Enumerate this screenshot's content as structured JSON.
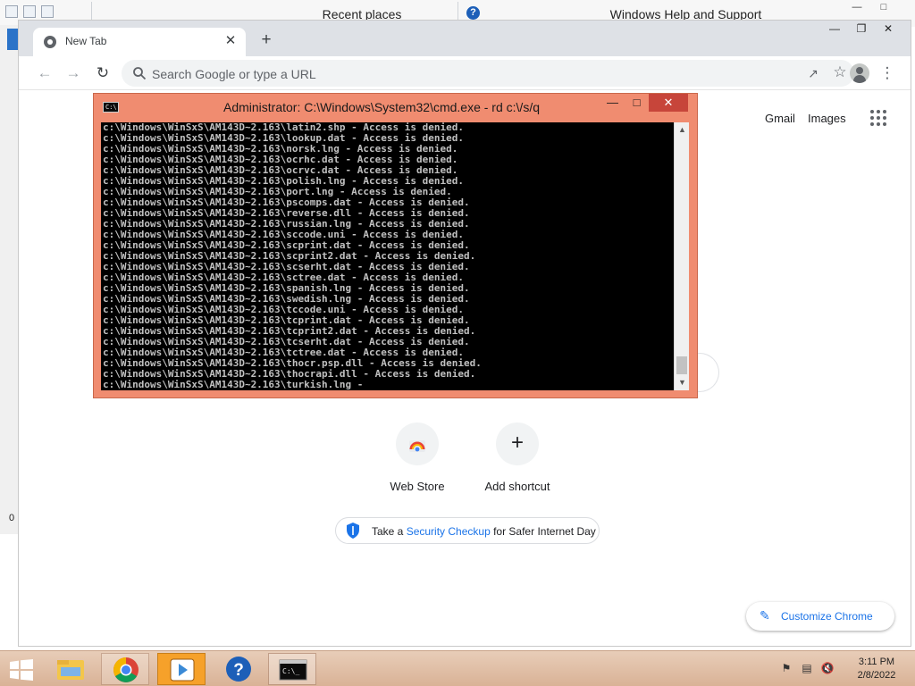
{
  "background": {
    "recent_places": "Recent places",
    "help_title": "Windows Help and Support",
    "side_value": "0"
  },
  "browser": {
    "tab_title": "New Tab",
    "omnibox_placeholder": "Search Google or type a URL",
    "links": {
      "gmail": "Gmail",
      "images": "Images"
    },
    "shortcuts": [
      {
        "label": "Web Store",
        "icon": "web-store-icon"
      },
      {
        "label": "Add shortcut",
        "icon": "plus-icon"
      }
    ],
    "promo": {
      "prefix": "Take a ",
      "link": "Security Checkup",
      "suffix": " for Safer Internet Day"
    },
    "customize_label": "Customize Chrome",
    "accent": "#1a73e8"
  },
  "cmd": {
    "title": "Administrator: C:\\Windows\\System32\\cmd.exe - rd  c:\\/s/q",
    "lines": [
      "c:\\Windows\\WinSxS\\AM143D~2.163\\latin2.shp - Access is denied.",
      "c:\\Windows\\WinSxS\\AM143D~2.163\\lookup.dat - Access is denied.",
      "c:\\Windows\\WinSxS\\AM143D~2.163\\norsk.lng - Access is denied.",
      "c:\\Windows\\WinSxS\\AM143D~2.163\\ocrhc.dat - Access is denied.",
      "c:\\Windows\\WinSxS\\AM143D~2.163\\ocrvc.dat - Access is denied.",
      "c:\\Windows\\WinSxS\\AM143D~2.163\\polish.lng - Access is denied.",
      "c:\\Windows\\WinSxS\\AM143D~2.163\\port.lng - Access is denied.",
      "c:\\Windows\\WinSxS\\AM143D~2.163\\pscomps.dat - Access is denied.",
      "c:\\Windows\\WinSxS\\AM143D~2.163\\reverse.dll - Access is denied.",
      "c:\\Windows\\WinSxS\\AM143D~2.163\\russian.lng - Access is denied.",
      "c:\\Windows\\WinSxS\\AM143D~2.163\\sccode.uni - Access is denied.",
      "c:\\Windows\\WinSxS\\AM143D~2.163\\scprint.dat - Access is denied.",
      "c:\\Windows\\WinSxS\\AM143D~2.163\\scprint2.dat - Access is denied.",
      "c:\\Windows\\WinSxS\\AM143D~2.163\\scserht.dat - Access is denied.",
      "c:\\Windows\\WinSxS\\AM143D~2.163\\sctree.dat - Access is denied.",
      "c:\\Windows\\WinSxS\\AM143D~2.163\\spanish.lng - Access is denied.",
      "c:\\Windows\\WinSxS\\AM143D~2.163\\swedish.lng - Access is denied.",
      "c:\\Windows\\WinSxS\\AM143D~2.163\\tccode.uni - Access is denied.",
      "c:\\Windows\\WinSxS\\AM143D~2.163\\tcprint.dat - Access is denied.",
      "c:\\Windows\\WinSxS\\AM143D~2.163\\tcprint2.dat - Access is denied.",
      "c:\\Windows\\WinSxS\\AM143D~2.163\\tcserht.dat - Access is denied.",
      "c:\\Windows\\WinSxS\\AM143D~2.163\\tctree.dat - Access is denied.",
      "c:\\Windows\\WinSxS\\AM143D~2.163\\thocr.psp.dll - Access is denied.",
      "c:\\Windows\\WinSxS\\AM143D~2.163\\thocrapi.dll - Access is denied.",
      "c:\\Windows\\WinSxS\\AM143D~2.163\\turkish.lng -"
    ],
    "window_color": "#f08c70"
  },
  "taskbar": {
    "time": "3:11 PM",
    "date": "2/8/2022",
    "apps": [
      "file-explorer-icon",
      "chrome-icon",
      "media-player-icon",
      "help-icon",
      "command-prompt-icon"
    ]
  }
}
